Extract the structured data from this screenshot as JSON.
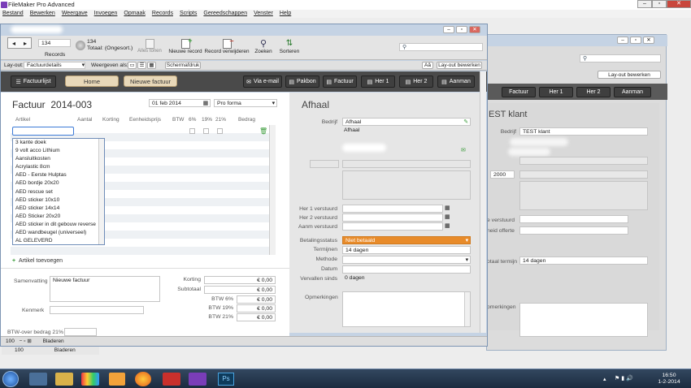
{
  "app": {
    "title": "FileMaker Pro Advanced"
  },
  "menu": [
    "Bestand",
    "Bewerken",
    "Weergave",
    "Invoegen",
    "Opmaak",
    "Records",
    "Scripts",
    "Gereedschappen",
    "Venster",
    "Help"
  ],
  "toolbar": {
    "record_field": "134",
    "records_count": "134",
    "records_sort": "Totaal: (Ongesort.)",
    "records_label": "Records",
    "show_all": "Alles tonen",
    "new_record": "Nieuwe record",
    "delete_record": "Record verwijderen",
    "find": "Zoeken",
    "sort": "Sorteren"
  },
  "layoutbar": {
    "layout_label": "Lay-out:",
    "layout_value": "Factuurdetails",
    "view_as": "Weergeven als:",
    "preview": "Schermafdruk",
    "aa": "Aâ",
    "edit_layout": "Lay-out bewerken"
  },
  "navbar": {
    "list": "Factuurlijst",
    "home": "Home",
    "new_invoice": "Nieuwe factuur",
    "email": "Via e-mail",
    "pakbon": "Pakbon",
    "factuur": "Factuur",
    "her1": "Her 1",
    "her2": "Her 2",
    "aanmaning": "Aanman"
  },
  "invoice": {
    "title": "Factuur",
    "number": "2014-003",
    "date": "01 feb 2014",
    "type": "Pro forma",
    "columns": [
      "Artikel",
      "Aantal",
      "Korting",
      "Eenheidsprijs",
      "BTW",
      "6%",
      "19%",
      "21%",
      "Bedrag"
    ],
    "dropdown_items": [
      "3 kante doek",
      "9 volt acco Lithium",
      "Aansluitkosten",
      "Acrylastic 8cm",
      "AED - Eerste Hulptas",
      "AED bordje 20x20",
      "AED rescue set",
      "AED sticker 10x10",
      "AED sticker 14x14",
      "AED Sticker 20x20",
      "AED sticker in dit gebouw reverse",
      "AED wandbeugel (universeel)",
      "AL GELEVERD"
    ],
    "add_article": "Artikel toevoegen",
    "summary_label": "Samenvatting",
    "summary_value": "Nieuwe factuur",
    "kenmerk_label": "Kenmerk",
    "totals": [
      {
        "label": "Korting",
        "value": "€ 0,00"
      },
      {
        "label": "Subtotaal",
        "value": "€ 0,00"
      },
      {
        "label": "BTW 6%",
        "value": "€ 0,00"
      },
      {
        "label": "BTW 19%",
        "value": "€ 0,00"
      },
      {
        "label": "BTW 21%",
        "value": "€ 0,00"
      }
    ],
    "btw_over": "BTW-over bedrag 21%"
  },
  "customer": {
    "heading": "Afhaal",
    "bedrijf_label": "Bedrijf",
    "bedrijf_value": "Afhaal",
    "address_line": "Afhaal",
    "her1_label": "Her 1 verstuurd",
    "her2_label": "Her 2 verstuurd",
    "aanm_label": "Aanm verstuurd",
    "status_label": "Betalingsstatus",
    "status_value": "Niet betaald",
    "terms_label": "Termijnen",
    "terms_value": "14 dagen",
    "method_label": "Methode",
    "date_label": "Datum",
    "overdue_label": "Vervallen sinds",
    "overdue_value": "0 dagen",
    "remarks_label": "Opmerkingen"
  },
  "statusbar": {
    "zoom": "100",
    "mode": "Bladeren"
  },
  "background_window": {
    "edit_layout": "Lay-out bewerken",
    "buttons": [
      "Factuur",
      "Her 1",
      "Her 2",
      "Aanman"
    ],
    "heading": "EST klant",
    "bedrijf_label": "Bedrijf",
    "bedrijf_value": "TEST klant",
    "year": "2000",
    "her_label": "e verstuurd",
    "offerte_label": "neid offerte",
    "terms_label": "otaal termijn",
    "terms_value": "14 dagen",
    "remarks_label": "pmerkingen",
    "zoom": "100",
    "mode": "Bladeren"
  },
  "taskbar": {
    "time": "16:50",
    "date": "1-2-2014"
  },
  "colors": {
    "status_orange": "#e88b2a",
    "title_blue": "#c5d3e4"
  }
}
